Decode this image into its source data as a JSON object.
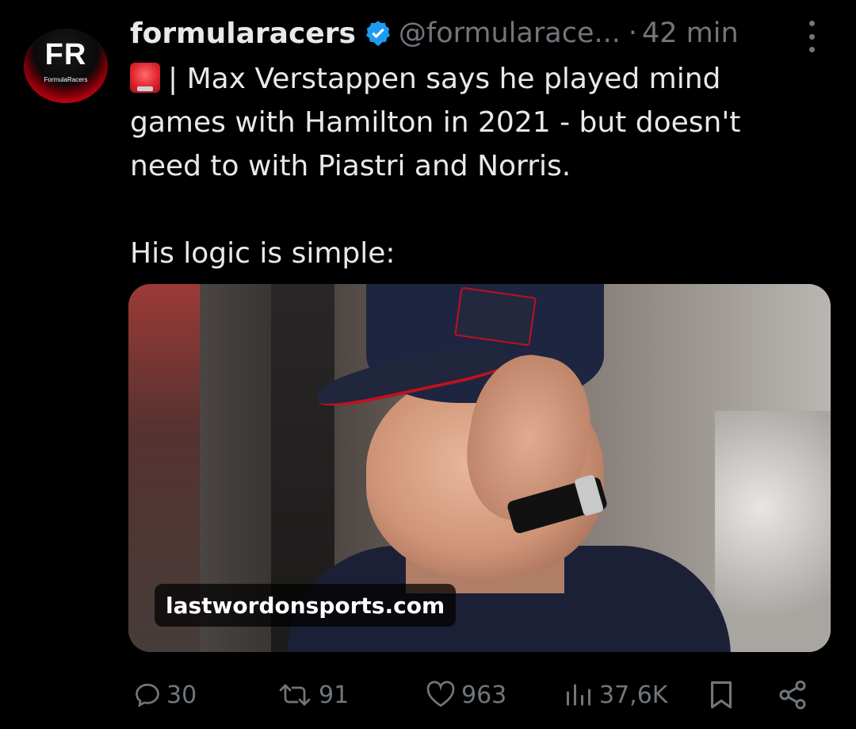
{
  "account": {
    "avatar_logo": "FR",
    "avatar_subtitle": "FormulaRacers",
    "display_name": "formularacers",
    "verified_icon": "verified-badge-icon",
    "handle": "@formularace...",
    "separator": "·",
    "time": "42 min"
  },
  "tweet": {
    "emoji_icon": "police-light-emoji",
    "text_line1": "| Max Verstappen says he played mind",
    "text_rest": "games with Hamilton in 2021 - but doesn't\nneed to with Piastri and Norris.\n\nHis logic is simple:"
  },
  "media": {
    "source_label": "lastwordonsports.com"
  },
  "actions": {
    "reply_count": "30",
    "retweet_count": "91",
    "like_count": "963",
    "views_count": "37,6K"
  },
  "colors": {
    "background": "#000000",
    "text": "#e7e9ea",
    "muted": "#71767b",
    "verified": "#1d9bf0"
  }
}
